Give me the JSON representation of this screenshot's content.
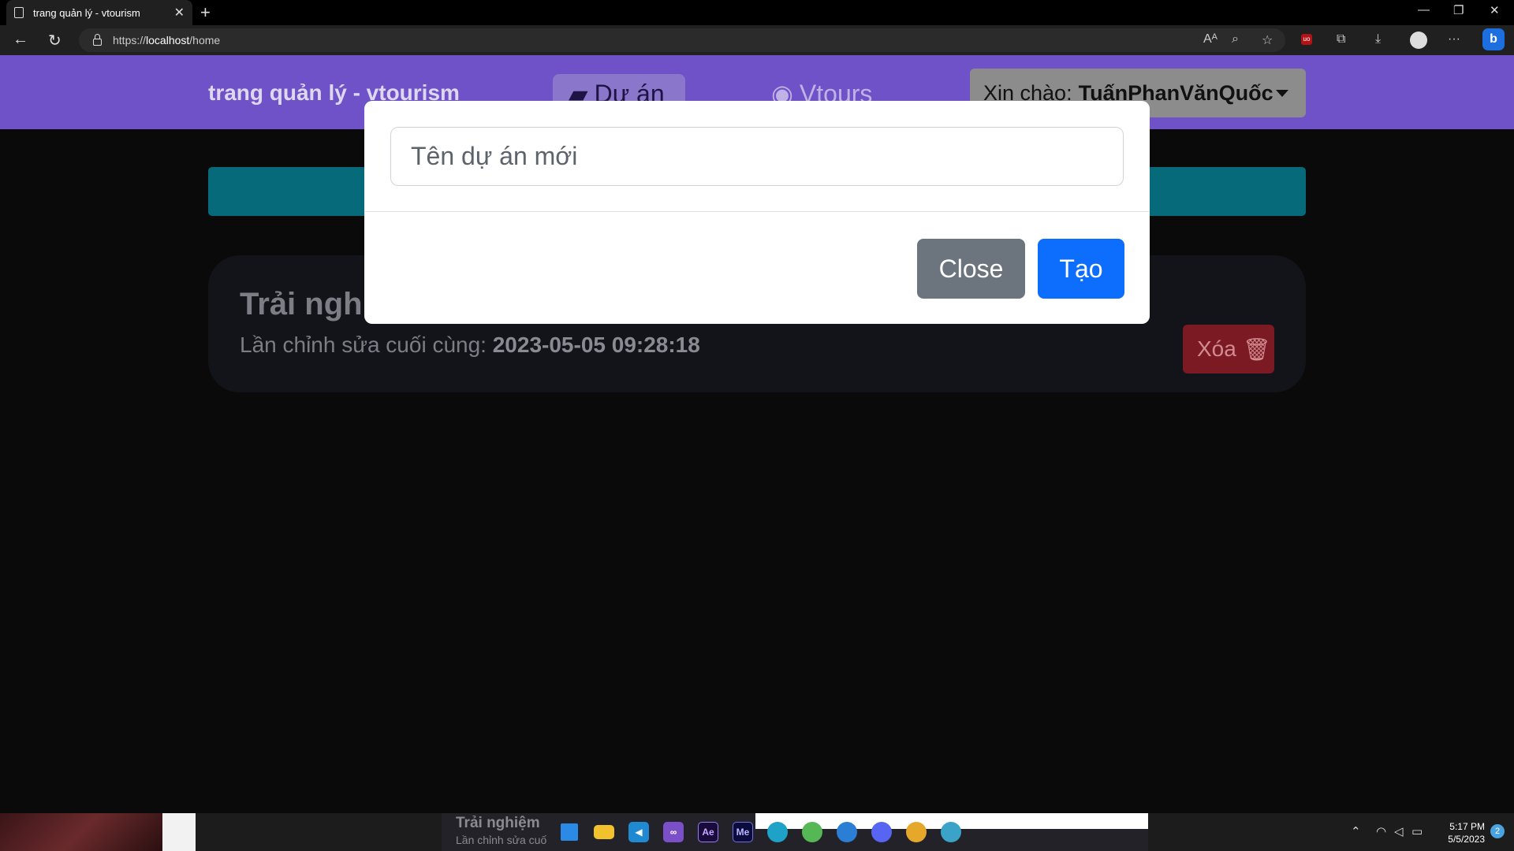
{
  "browser": {
    "tab_title": "trang quản lý - vtourism",
    "url_scheme": "https://",
    "url_host": "localhost",
    "url_path": "/home"
  },
  "navbar": {
    "brand": "trang quản lý - vtourism",
    "projects_label": "Dự án",
    "vtours_label": "Vtours",
    "greeting": "Xin chào:",
    "username": "TuấnPhanVănQuốc"
  },
  "project": {
    "title": "Trải nghiệm",
    "last_edited_label": "Lần chỉnh sửa cuối cùng:",
    "last_edited_value": "2023-05-05 09:28:18",
    "delete_label": "Xóa"
  },
  "modal": {
    "input_placeholder": "Tên dự án mới",
    "close_label": "Close",
    "create_label": "Tạo"
  },
  "taskbar": {
    "preview_title": "Trải nghiệm",
    "preview_sub": "Lần chỉnh sửa cuố",
    "time": "5:17 PM",
    "date": "5/5/2023",
    "notifications": "2",
    "apps": [
      "start-icon",
      "file-explorer-icon",
      "vscode-icon",
      "visual-studio-icon",
      "after-effects-icon",
      "media-encoder-icon",
      "edge-icon",
      "chrome-canary-icon",
      "edge-beta-icon",
      "discord-icon",
      "chrome-dev-icon",
      "edge-dev-icon"
    ]
  },
  "colors": {
    "navbar": "#6f51c8",
    "primary": "#0d6efd",
    "secondary": "#6c757d",
    "danger": "#7b1a22",
    "info": "#066a7a"
  }
}
